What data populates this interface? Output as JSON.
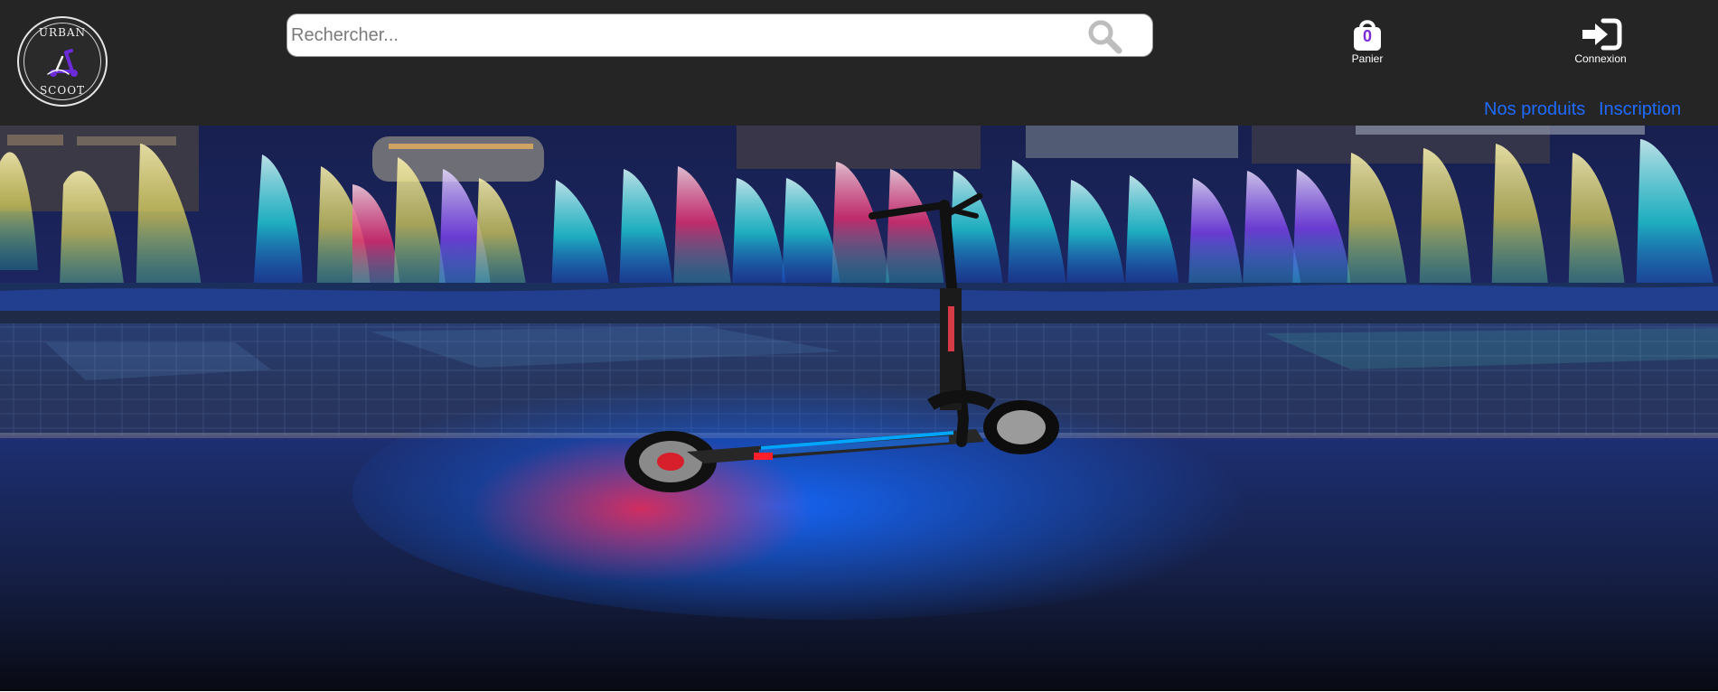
{
  "brand": {
    "logo_top": "URBAN",
    "logo_bottom": "SCOOT",
    "logo_mark_icon": "scooter-logo-icon"
  },
  "search": {
    "placeholder": "Rechercher...",
    "icon": "search-icon"
  },
  "cart": {
    "count": "0",
    "label": "Panier",
    "icon": "shopping-bag-icon"
  },
  "login": {
    "label": "Connexion",
    "icon": "sign-in-icon"
  },
  "nav": {
    "products": "Nos produits",
    "signup": "Inscription"
  },
  "hero": {
    "image": "illuminated-fountains-electric-scooter-night"
  },
  "colors": {
    "header_background": "#252525",
    "link_blue": "#1f6bff",
    "cart_accent": "#7a2bd6",
    "logo_purple": "#6c2bd9"
  }
}
